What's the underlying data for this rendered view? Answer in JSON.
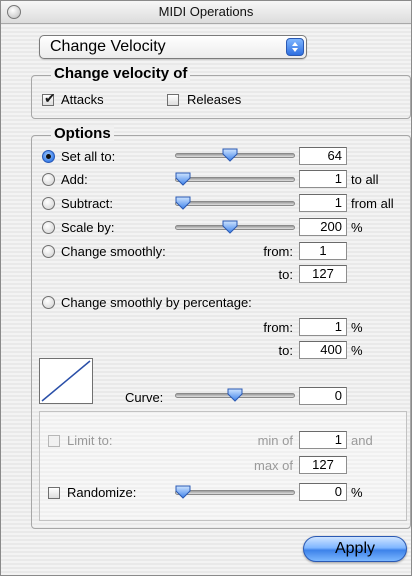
{
  "window": {
    "title": "MIDI Operations"
  },
  "operation": {
    "selected": "Change Velocity"
  },
  "change_velocity_of": {
    "legend": "Change velocity of",
    "attacks": {
      "label": "Attacks",
      "checked": true
    },
    "releases": {
      "label": "Releases",
      "checked": false
    }
  },
  "options": {
    "legend": "Options",
    "set_all": {
      "label": "Set all to:",
      "value": "64",
      "selected": true,
      "slider_level": 0.45
    },
    "add": {
      "label": "Add:",
      "value": "1",
      "suffix": "to all",
      "slider_level": 0.0
    },
    "subtract": {
      "label": "Subtract:",
      "value": "1",
      "suffix": "from all",
      "slider_level": 0.0
    },
    "scale": {
      "label": "Scale by:",
      "value": "200",
      "suffix": "%",
      "slider_level": 0.45
    },
    "change_smoothly": {
      "label": "Change smoothly:",
      "from_label": "from:",
      "from_value": "1",
      "to_label": "to:",
      "to_value": "127"
    },
    "change_smoothly_pct": {
      "label": "Change smoothly by percentage:",
      "from_label": "from:",
      "from_value": "1",
      "from_suffix": "%",
      "to_label": "to:",
      "to_value": "400",
      "to_suffix": "%"
    },
    "curve": {
      "label": "Curve:",
      "value": "0",
      "slider_level": 0.5
    }
  },
  "limit": {
    "label": "Limit to:",
    "min_label": "min of",
    "min_value": "1",
    "and_label": "and",
    "max_label": "max of",
    "max_value": "127"
  },
  "randomize": {
    "label": "Randomize:",
    "value": "0",
    "suffix": "%",
    "slider_level": 0.0
  },
  "apply": {
    "label": "Apply"
  }
}
